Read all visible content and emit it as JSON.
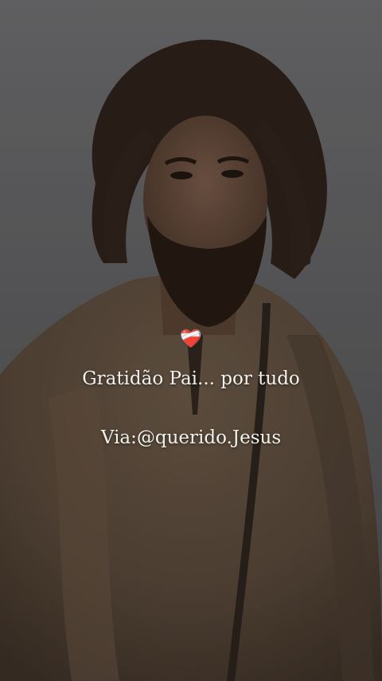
{
  "post": {
    "heart_emoji": "❤️‍🩹",
    "caption": "Gratidão Pai... por tudo",
    "credit": "Via:@querido.Jesus"
  },
  "colors": {
    "text": "#f4f1ec",
    "background": "#5f5f61",
    "robe": "#5a4a3c",
    "hair": "#2a1e16"
  },
  "icons": [
    "mending-heart-icon"
  ]
}
